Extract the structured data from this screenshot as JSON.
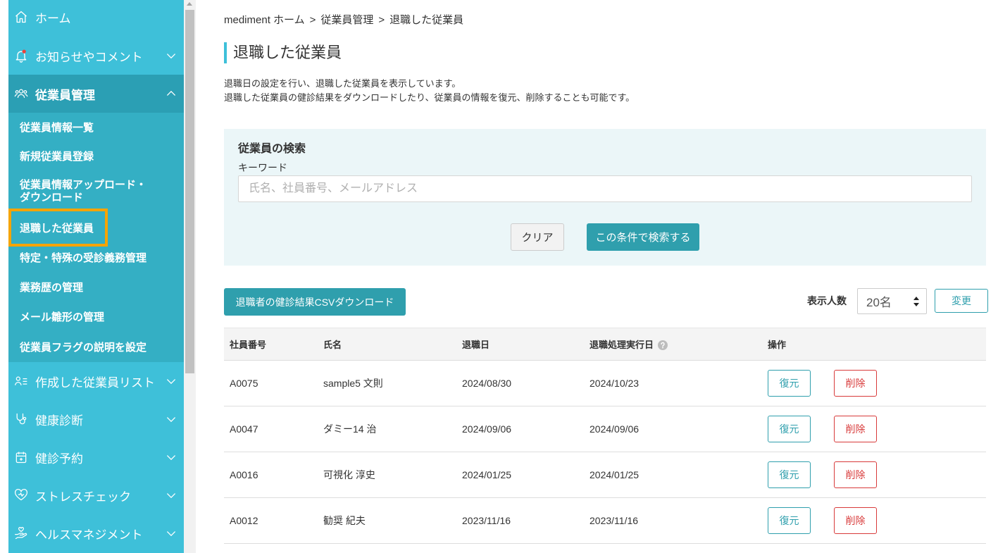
{
  "colors": {
    "sidebar_bg": "#3ec0d9",
    "sidebar_active": "#2b9fb4",
    "sidebar_sub": "#34afc4",
    "primary": "#2f9fad",
    "danger": "#d83a3a",
    "panel_bg": "#ebf6f8",
    "highlight": "#f5a400",
    "notification_dot": "#e8433a"
  },
  "sidebar": {
    "items": [
      {
        "label": "ホーム",
        "icon": "home-icon"
      },
      {
        "label": "お知らせやコメント",
        "icon": "bell-icon",
        "has_notification": true
      },
      {
        "label": "従業員管理",
        "icon": "people-icon",
        "expanded": true
      }
    ],
    "submenu": [
      {
        "label": "従業員情報一覧"
      },
      {
        "label": "新規従業員登録"
      },
      {
        "label": "従業員情報アップロード・ダウンロード"
      },
      {
        "label": "退職した従業員",
        "selected": true
      },
      {
        "label": "特定・特殊の受診義務管理"
      },
      {
        "label": "業務歴の管理"
      },
      {
        "label": "メール雛形の管理"
      },
      {
        "label": "従業員フラグの説明を設定"
      }
    ],
    "lower_items": [
      {
        "label": "作成した従業員リスト",
        "icon": "employee-list-icon"
      },
      {
        "label": "健康診断",
        "icon": "stethoscope-icon"
      },
      {
        "label": "健診予約",
        "icon": "calendar-icon"
      },
      {
        "label": "ストレスチェック",
        "icon": "heart-pulse-icon"
      },
      {
        "label": "ヘルスマネジメント",
        "icon": "hand-heart-icon"
      }
    ]
  },
  "breadcrumb": {
    "items": [
      "mediment ホーム",
      "従業員管理",
      "退職した従業員"
    ],
    "separator": ">"
  },
  "page": {
    "title": "退職した従業員",
    "description": [
      "退職日の設定を行い、退職した従業員を表示しています。",
      "退職した従業員の健診結果をダウンロードしたり、従業員の情報を復元、削除することも可能です。"
    ]
  },
  "search": {
    "title": "従業員の検索",
    "keyword_label": "キーワード",
    "keyword_value": "",
    "placeholder": "氏名、社員番号、メールアドレス",
    "clear_label": "クリア",
    "submit_label": "この条件で検索する"
  },
  "toolbar": {
    "download_label": "退職者の健診結果CSVダウンロード",
    "per_page_label": "表示人数",
    "per_page_value": "20名",
    "change_label": "変更"
  },
  "table": {
    "columns": [
      "社員番号",
      "氏名",
      "退職日",
      "退職処理実行日",
      "操作"
    ],
    "restore_label": "復元",
    "delete_label": "削除",
    "rows": [
      {
        "id": "A0075",
        "name": "sample5 文則",
        "retired_date": "2024/08/30",
        "processed_date": "2024/10/23"
      },
      {
        "id": "A0047",
        "name": "ダミー14 治",
        "retired_date": "2024/09/06",
        "processed_date": "2024/09/06"
      },
      {
        "id": "A0016",
        "name": "可視化 淳史",
        "retired_date": "2024/01/25",
        "processed_date": "2024/01/25"
      },
      {
        "id": "A0012",
        "name": "勧奨 紀夫",
        "retired_date": "2023/11/16",
        "processed_date": "2023/11/16"
      }
    ]
  }
}
